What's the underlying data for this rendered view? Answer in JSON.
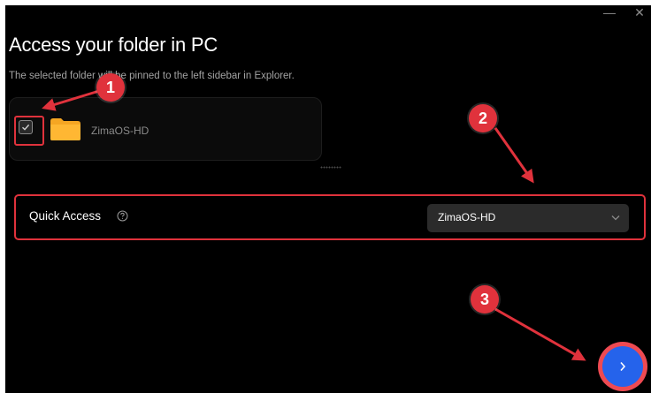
{
  "window": {
    "minimize_icon": "minimize-icon",
    "close_icon": "close-icon",
    "minimize_glyph": "—",
    "close_glyph": "✕"
  },
  "header": {
    "title": "Access your folder in PC",
    "subtitle": "The selected folder will be pinned to the left sidebar in Explorer."
  },
  "folder": {
    "name": "ZimaOS-HD",
    "checked": true,
    "icon": "folder-icon",
    "folder_color": "#f5a623"
  },
  "quick_access": {
    "label": "Quick Access",
    "help_icon": "question-circle-icon",
    "selected": "ZimaOS-HD"
  },
  "next_button": {
    "glyph": "›",
    "icon": "chevron-right-icon",
    "color": "#2563eb"
  },
  "annotations": {
    "color": "#e0323c",
    "steps": [
      "1",
      "2",
      "3"
    ]
  }
}
